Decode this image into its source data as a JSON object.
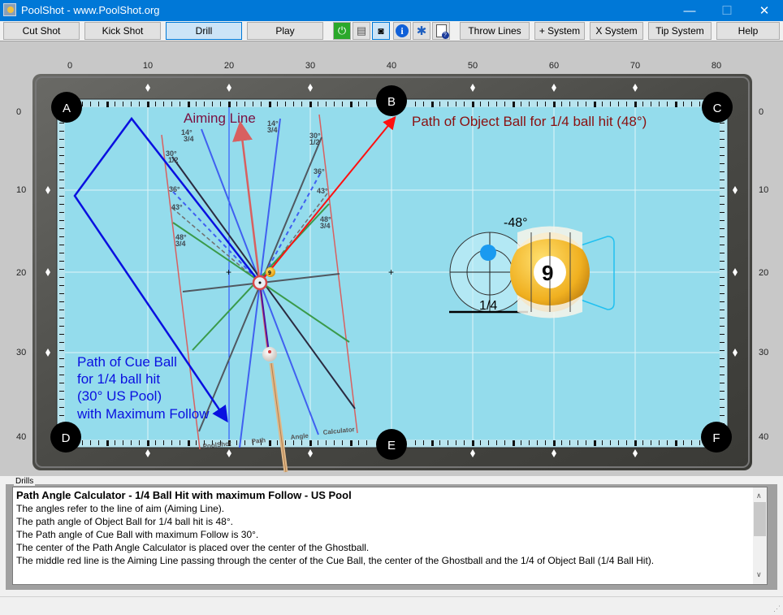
{
  "window": {
    "title": "PoolShot - www.PoolShot.org",
    "controls": {
      "minimize": "—",
      "maximize": "☐",
      "close": "✕"
    }
  },
  "toolbar": {
    "buttons": [
      {
        "label": "Cut Shot",
        "active": false
      },
      {
        "label": "Kick Shot",
        "active": false
      },
      {
        "label": "Drill",
        "active": true
      },
      {
        "label": "Play",
        "active": false
      }
    ],
    "icons": [
      {
        "name": "power-icon",
        "glyph": "⏻",
        "color": "#2aa02a"
      },
      {
        "name": "print-icon",
        "glyph": "🖶",
        "color": "#606060"
      },
      {
        "name": "camera-icon",
        "glyph": "📷",
        "color": "#000000"
      },
      {
        "name": "info-icon",
        "glyph": "i",
        "color": "#1060d8"
      },
      {
        "name": "settings-icon",
        "glyph": "✱",
        "color": "#2060c0"
      },
      {
        "name": "help-document-icon",
        "glyph": "?",
        "color": "#1a3a9a"
      }
    ],
    "right_buttons": [
      "Throw Lines",
      "+ System",
      "X System",
      "Tip System",
      "Help"
    ]
  },
  "table": {
    "ruler_top": [
      "0",
      "10",
      "20",
      "30",
      "40",
      "50",
      "60",
      "70",
      "80"
    ],
    "ruler_left": [
      "0",
      "10",
      "20",
      "30",
      "40"
    ],
    "ruler_right": [
      "0",
      "10",
      "20",
      "30",
      "40"
    ],
    "pockets": [
      "A",
      "B",
      "C",
      "D",
      "E",
      "F"
    ],
    "labels": {
      "aiming_line": "Aiming Line",
      "object_ball_path": "Path of Object Ball for 1/4 ball hit (48°)",
      "cue_ball_path": [
        "Path of Cue Ball",
        "for 1/4 ball hit",
        "(30° US Pool)",
        "with Maximum Follow"
      ],
      "calculator_text": [
        "PoolShot",
        "Path",
        "Angle",
        "Calculator"
      ]
    },
    "angle_marks": [
      {
        "deg": "14°",
        "frac": "3/4"
      },
      {
        "deg": "30°",
        "frac": "1/2"
      },
      {
        "deg": "36°",
        "frac": ""
      },
      {
        "deg": "43°",
        "frac": ""
      },
      {
        "deg": "48°",
        "frac": "3/4"
      }
    ],
    "object_ball_number": "9",
    "hit_indicator": {
      "angle": "-48°",
      "fraction": "1/4"
    },
    "colors": {
      "cloth": "#94dcec",
      "aiming_line": "#d86060",
      "object_path": "#ff1010",
      "cue_path": "#0a10e0",
      "label_maroon": "#7a1040",
      "label_darkred": "#8a1010"
    }
  },
  "drills": {
    "legend": "Drills",
    "heading": "Path Angle Calculator - 1/4 Ball Hit with maximum Follow - US Pool",
    "lines": [
      "The angles refer to the line of aim (Aiming Line).",
      "The path angle of Object Ball for 1/4 ball hit is 48°.",
      "The Path angle of Cue Ball with maximum Follow is 30°.",
      "The center of the Path Angle Calculator is placed over the center of the Ghostball.",
      "The middle red line is the Aiming Line passing through the center of the Cue Ball, the center of the Ghostball and the 1/4 of Object Ball (1/4 Ball Hit)."
    ]
  }
}
